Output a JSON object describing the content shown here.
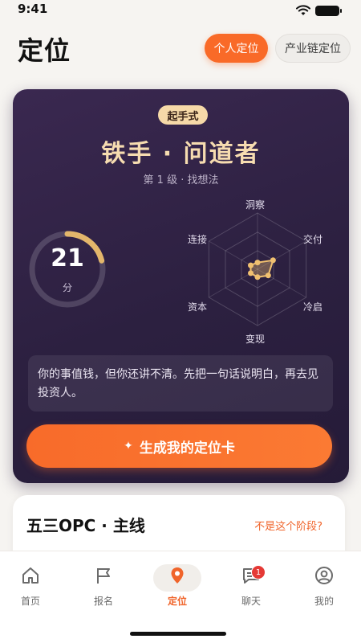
{
  "status_bar": {
    "time": "9:41"
  },
  "header": {
    "title": "定位",
    "segments": [
      {
        "label": "个人定位",
        "active": true
      },
      {
        "label": "产业链定位",
        "active": false
      }
    ]
  },
  "hero": {
    "badge": "起手式",
    "title": "铁手 · 问道者",
    "subtitle": "第 1 级 · 找想法",
    "score": {
      "value": "21",
      "unit": "分",
      "fraction": 0.21
    },
    "radar": {
      "axes": [
        "洞察",
        "交付",
        "冷启",
        "变现",
        "资本",
        "连接"
      ],
      "values": [
        0.12,
        0.32,
        0.22,
        0.14,
        0.14,
        0.14
      ],
      "accent_color": "#f0c070"
    },
    "hint": "你的事值钱，但你还讲不清。先把一句话说明白，再去见投资人。",
    "cta_label": "生成我的定位卡"
  },
  "track": {
    "title": "五三OPC · 主线",
    "link": "不是这个阶段?"
  },
  "tabs": [
    {
      "label": "首页",
      "icon": "home-icon"
    },
    {
      "label": "报名",
      "icon": "flag-icon"
    },
    {
      "label": "定位",
      "icon": "location-pin-icon",
      "active": true
    },
    {
      "label": "聊天",
      "icon": "chat-icon",
      "badge": "1"
    },
    {
      "label": "我的",
      "icon": "user-icon"
    }
  ],
  "colors": {
    "accent": "#f96a28",
    "card_bg": "#2c2040",
    "gold": "#f6dcb0"
  }
}
